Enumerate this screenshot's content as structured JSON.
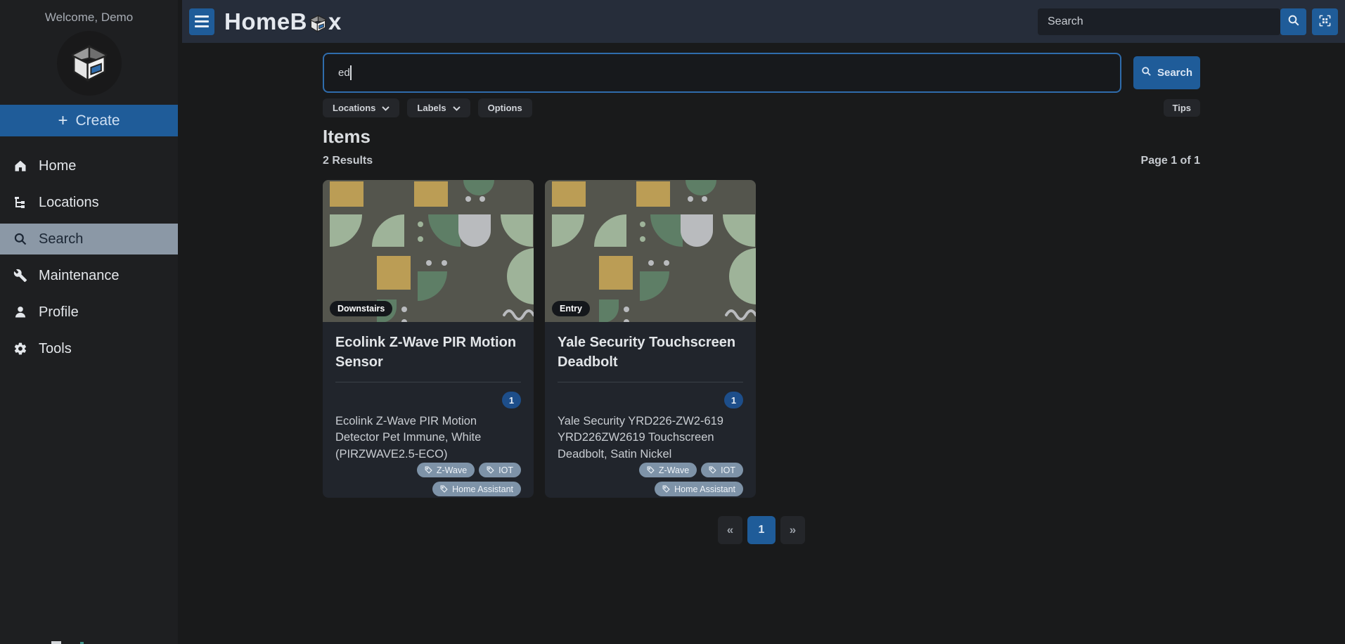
{
  "app": {
    "title_pre": "HomeB",
    "title_post": "x"
  },
  "navbar": {
    "search_placeholder": "Search"
  },
  "sidebar": {
    "welcome": "Welcome, Demo",
    "create_plus": "+",
    "create_label": "Create",
    "items": [
      {
        "label": "Home",
        "icon": "home-icon",
        "active": false
      },
      {
        "label": "Locations",
        "icon": "tree-icon",
        "active": false
      },
      {
        "label": "Search",
        "icon": "search-icon",
        "active": true
      },
      {
        "label": "Maintenance",
        "icon": "wrench-icon",
        "active": false
      },
      {
        "label": "Profile",
        "icon": "person-icon",
        "active": false
      },
      {
        "label": "Tools",
        "icon": "gear-icon",
        "active": false
      }
    ]
  },
  "search_panel": {
    "query": "ed",
    "filter_locations": "Locations",
    "filter_labels": "Labels",
    "filter_options": "Options",
    "search_button": "Search",
    "tips_button": "Tips"
  },
  "results": {
    "heading": "Items",
    "count_text": "2 Results",
    "page_text": "Page 1 of 1",
    "items": [
      {
        "location": "Downstairs",
        "title": "Ecolink Z-Wave PIR Motion Sensor",
        "quantity": "1",
        "description": "Ecolink Z-Wave PIR Motion Detector Pet Immune, White (PIRZWAVE2.5-ECO)",
        "labels": [
          "Z-Wave",
          "IOT",
          "Home Assistant"
        ]
      },
      {
        "location": "Entry",
        "title": "Yale Security Touchscreen Deadbolt",
        "quantity": "1",
        "description": "Yale Security YRD226-ZW2-619 YRD226ZW2619 Touchscreen Deadbolt, Satin Nickel",
        "labels": [
          "Z-Wave",
          "IOT",
          "Home Assistant"
        ]
      }
    ]
  },
  "pagination": {
    "prev": "«",
    "page": "1",
    "next": "»"
  },
  "colors": {
    "accent_blue": "#1f5c99",
    "active_nav_bg": "#8b98a6",
    "tag_pill_bg": "#7e93a8",
    "qty_badge_bg": "#1d4e8a",
    "navbar_bg": "#262d3a",
    "card_bg": "#21252c",
    "art_bg": "#54554d"
  }
}
